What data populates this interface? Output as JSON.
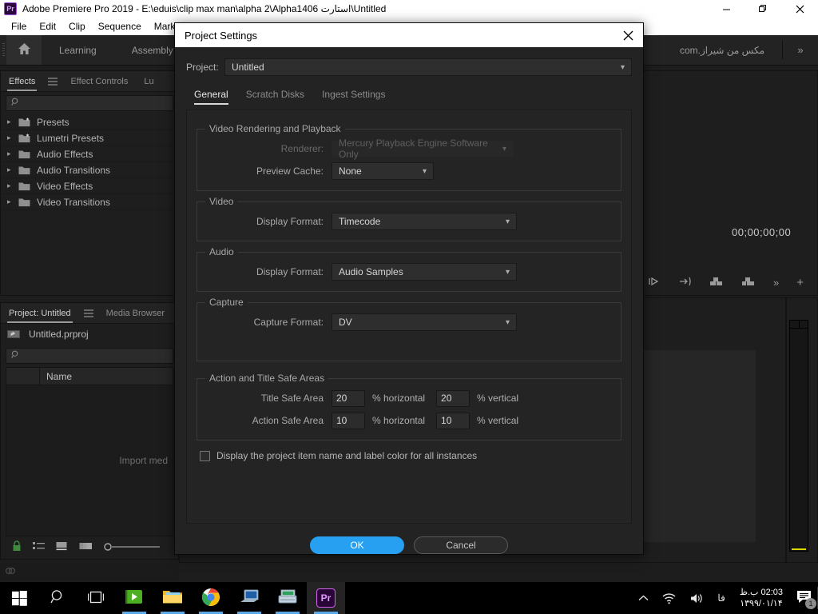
{
  "window": {
    "app_badge": "Pr",
    "title": "Adobe Premiere Pro 2019 - E:\\eduis\\clip max man\\alpha 2\\Alpha1406 استارت\\Untitled",
    "minimize": "minimize-icon",
    "restore": "restore-icon",
    "close": "close-icon"
  },
  "menubar": {
    "items": [
      {
        "label": "File"
      },
      {
        "label": "Edit"
      },
      {
        "label": "Clip"
      },
      {
        "label": "Sequence"
      },
      {
        "label": "Markers"
      }
    ]
  },
  "workspace": {
    "home_icon": "home-icon",
    "tabs": [
      {
        "label": "Learning"
      },
      {
        "label": "Assembly"
      },
      {
        "label": "مکس من شیراز.com"
      }
    ],
    "overflow": "»"
  },
  "effects_panel": {
    "tabs": [
      {
        "label": "Effects",
        "active": true
      },
      {
        "label": "Effect Controls",
        "active": false
      },
      {
        "label": "Lu",
        "active": false
      }
    ],
    "menu_icon": "panel-menu-icon",
    "search": {
      "placeholder": "",
      "value": "",
      "icon": "search-icon"
    },
    "items": [
      {
        "label": "Presets",
        "icon": "preset-folder-icon"
      },
      {
        "label": "Lumetri Presets",
        "icon": "preset-folder-icon"
      },
      {
        "label": "Audio Effects",
        "icon": "folder-icon"
      },
      {
        "label": "Audio Transitions",
        "icon": "folder-icon"
      },
      {
        "label": "Video Effects",
        "icon": "folder-icon"
      },
      {
        "label": "Video Transitions",
        "icon": "folder-icon"
      }
    ]
  },
  "project_panel": {
    "tabs": [
      {
        "label": "Project: Untitled",
        "active": true
      },
      {
        "label": "Media Browser",
        "active": false
      }
    ],
    "menu_icon": "panel-menu-icon",
    "file_name": "Untitled.prproj",
    "file_icon": "project-file-icon",
    "search": {
      "placeholder": "",
      "value": "",
      "icon": "search-icon"
    },
    "column_header": "Name",
    "empty_hint": "Import med",
    "footer_icons": [
      "lock-icon",
      "list-view-icon",
      "icon-view-icon",
      "freeform-view-icon",
      "zoom-slider"
    ]
  },
  "monitor": {
    "timecode": "00;00;00;00",
    "controls": [
      "export-frame-icon",
      "insert-icon",
      "overwrite-icon",
      "lift-icon",
      "more-icon",
      "add-icon"
    ]
  },
  "dialog": {
    "title": "Project Settings",
    "close_icon": "close-icon",
    "project_label": "Project:",
    "project_value": "Untitled",
    "tabs": [
      {
        "label": "General",
        "active": true
      },
      {
        "label": "Scratch Disks",
        "active": false
      },
      {
        "label": "Ingest Settings",
        "active": false
      }
    ],
    "groups": {
      "video_rendering": {
        "legend": "Video Rendering and Playback",
        "renderer": {
          "label": "Renderer:",
          "value": "Mercury Playback Engine Software Only",
          "disabled": true
        },
        "preview_cache": {
          "label": "Preview Cache:",
          "value": "None",
          "disabled": false
        }
      },
      "video": {
        "legend": "Video",
        "display_format": {
          "label": "Display Format:",
          "value": "Timecode"
        }
      },
      "audio": {
        "legend": "Audio",
        "display_format": {
          "label": "Display Format:",
          "value": "Audio Samples"
        }
      },
      "capture": {
        "legend": "Capture",
        "capture_format": {
          "label": "Capture Format:",
          "value": "DV"
        }
      },
      "safe_areas": {
        "legend": "Action and Title Safe Areas",
        "title_safe": {
          "label": "Title Safe Area",
          "horizontal": "20",
          "horizontal_unit": "% horizontal",
          "vertical": "20",
          "vertical_unit": "% vertical"
        },
        "action_safe": {
          "label": "Action Safe Area",
          "horizontal": "10",
          "horizontal_unit": "% horizontal",
          "vertical": "10",
          "vertical_unit": "% vertical"
        }
      }
    },
    "display_checkbox": {
      "label": "Display the project item name and label color for all instances",
      "checked": false
    },
    "ok_label": "OK",
    "cancel_label": "Cancel",
    "accent_color": "#27a0f2"
  },
  "taskbar": {
    "start": "windows-start-icon",
    "search": "search-icon",
    "task_view": "task-view-icon",
    "apps": [
      {
        "name": "camtasia-icon"
      },
      {
        "name": "file-explorer-icon"
      },
      {
        "name": "google-chrome-icon"
      },
      {
        "name": "media-app-icon"
      },
      {
        "name": "scanner-app-icon"
      },
      {
        "name": "premiere-pro-icon",
        "label": "Pr",
        "active": true
      }
    ],
    "tray": {
      "chevron": "show-hidden-icons-icon",
      "network": "wifi-icon",
      "volume": "volume-icon",
      "language": "فا",
      "time": "02:03 ب.ظ",
      "date": "۱۳۹۹/۰۱/۱۴",
      "notifications": "notifications-icon",
      "notification_count": "1"
    }
  }
}
